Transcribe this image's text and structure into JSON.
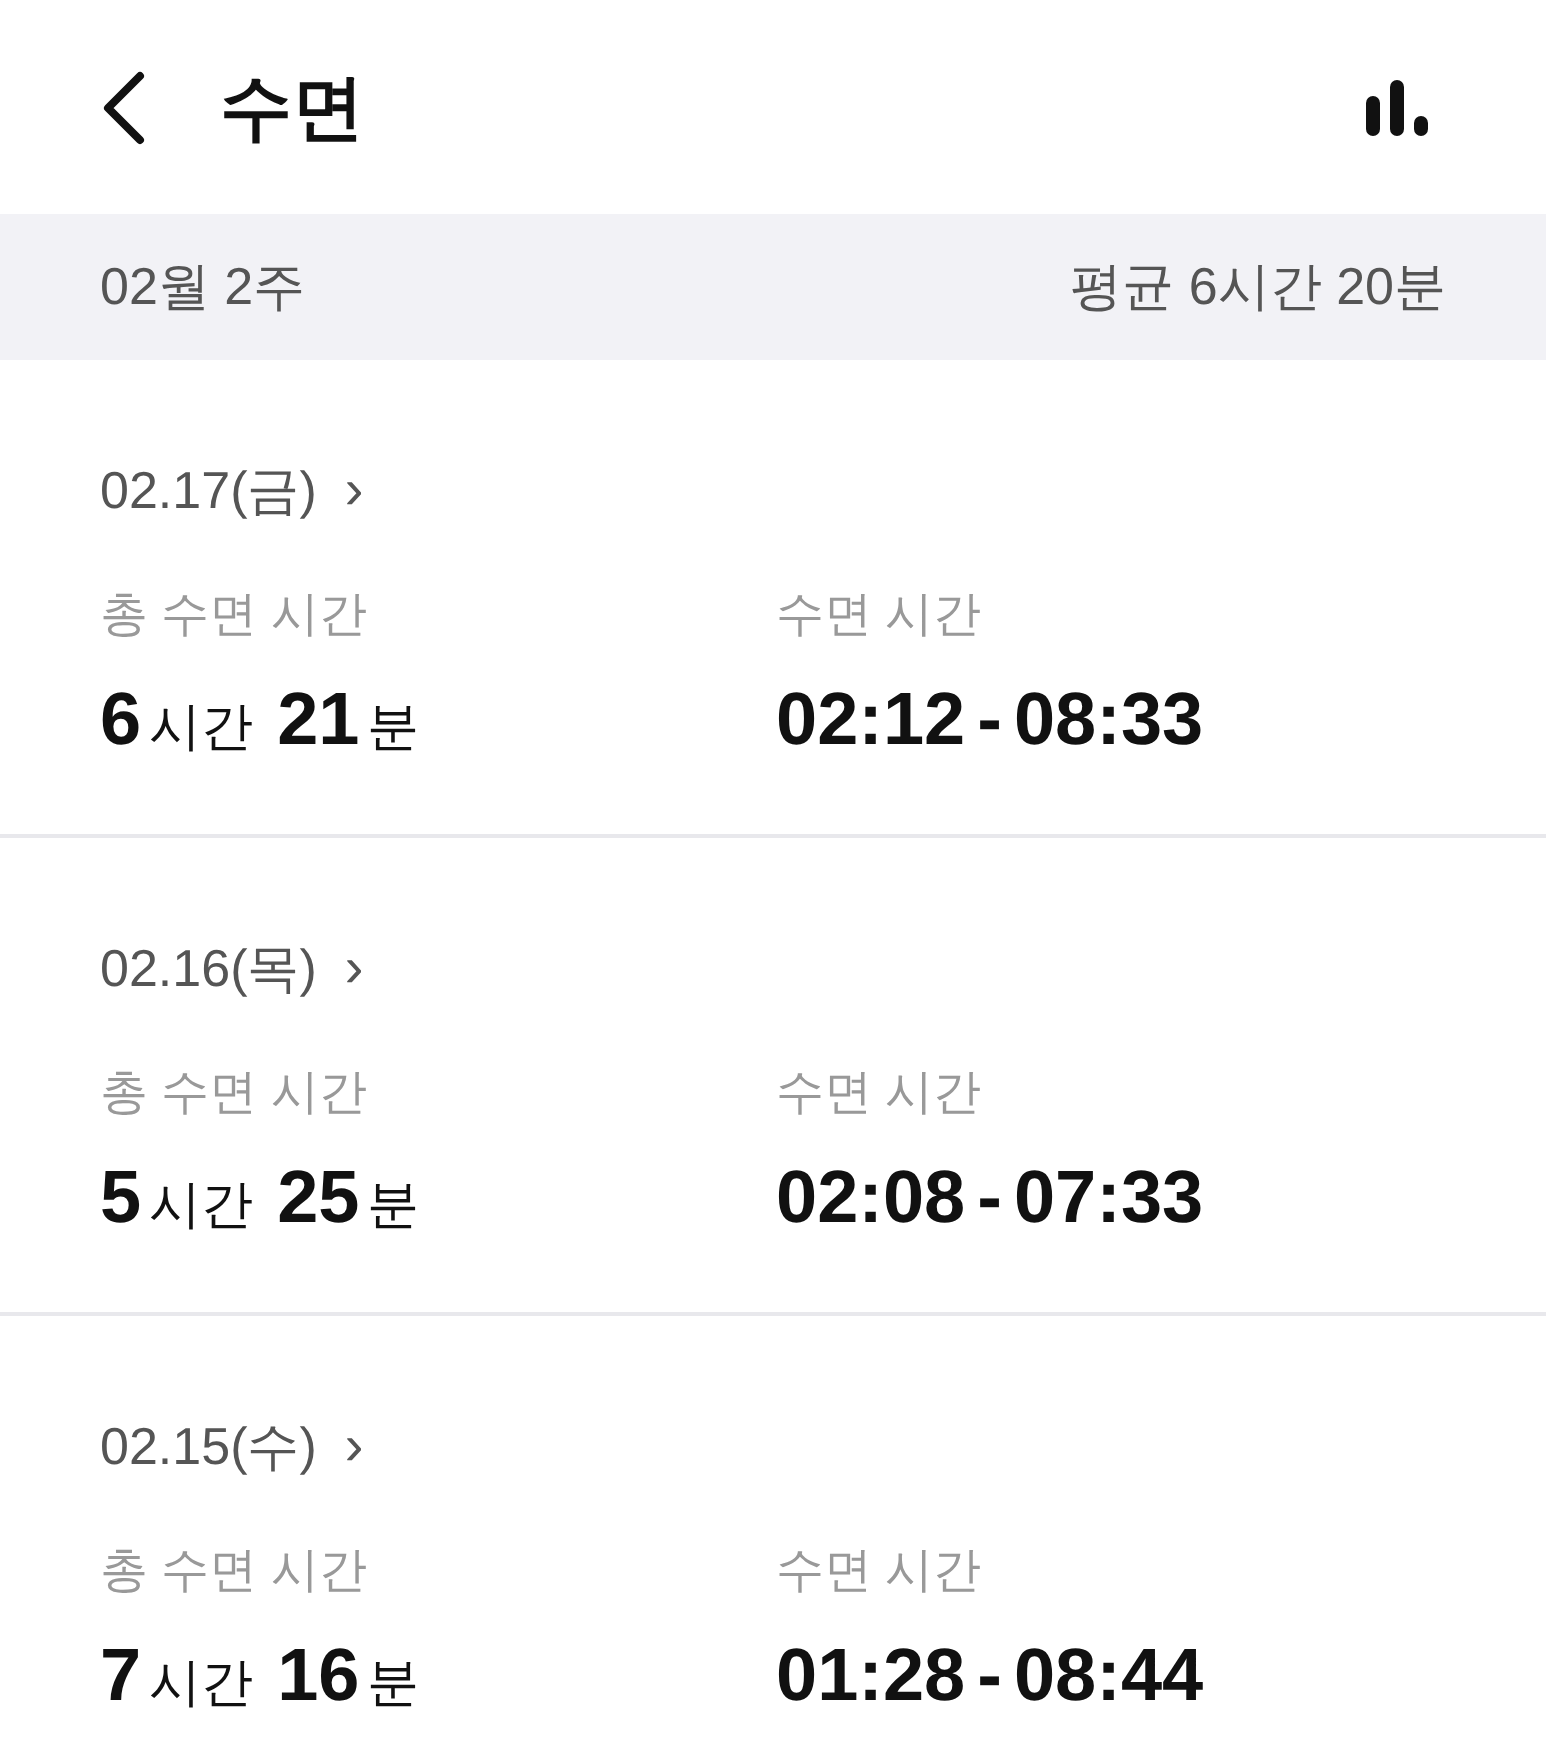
{
  "header": {
    "title": "수면"
  },
  "week": {
    "label": "02월 2주",
    "average": "평균 6시간 20분"
  },
  "days": [
    {
      "date": "02.17(금)",
      "chevron": "›",
      "total_label": "총 수면 시간",
      "hours": "6",
      "hours_unit": "시간",
      "minutes": "21",
      "minutes_unit": "분",
      "range_label": "수면 시간",
      "start": "02:12",
      "separator": "-",
      "end": "08:33"
    },
    {
      "date": "02.16(목)",
      "chevron": "›",
      "total_label": "총 수면 시간",
      "hours": "5",
      "hours_unit": "시간",
      "minutes": "25",
      "minutes_unit": "분",
      "range_label": "수면 시간",
      "start": "02:08",
      "separator": "-",
      "end": "07:33"
    },
    {
      "date": "02.15(수)",
      "chevron": "›",
      "total_label": "총 수면 시간",
      "hours": "7",
      "hours_unit": "시간",
      "minutes": "16",
      "minutes_unit": "분",
      "range_label": "수면 시간",
      "start": "01:28",
      "separator": "-",
      "end": "08:44"
    }
  ]
}
